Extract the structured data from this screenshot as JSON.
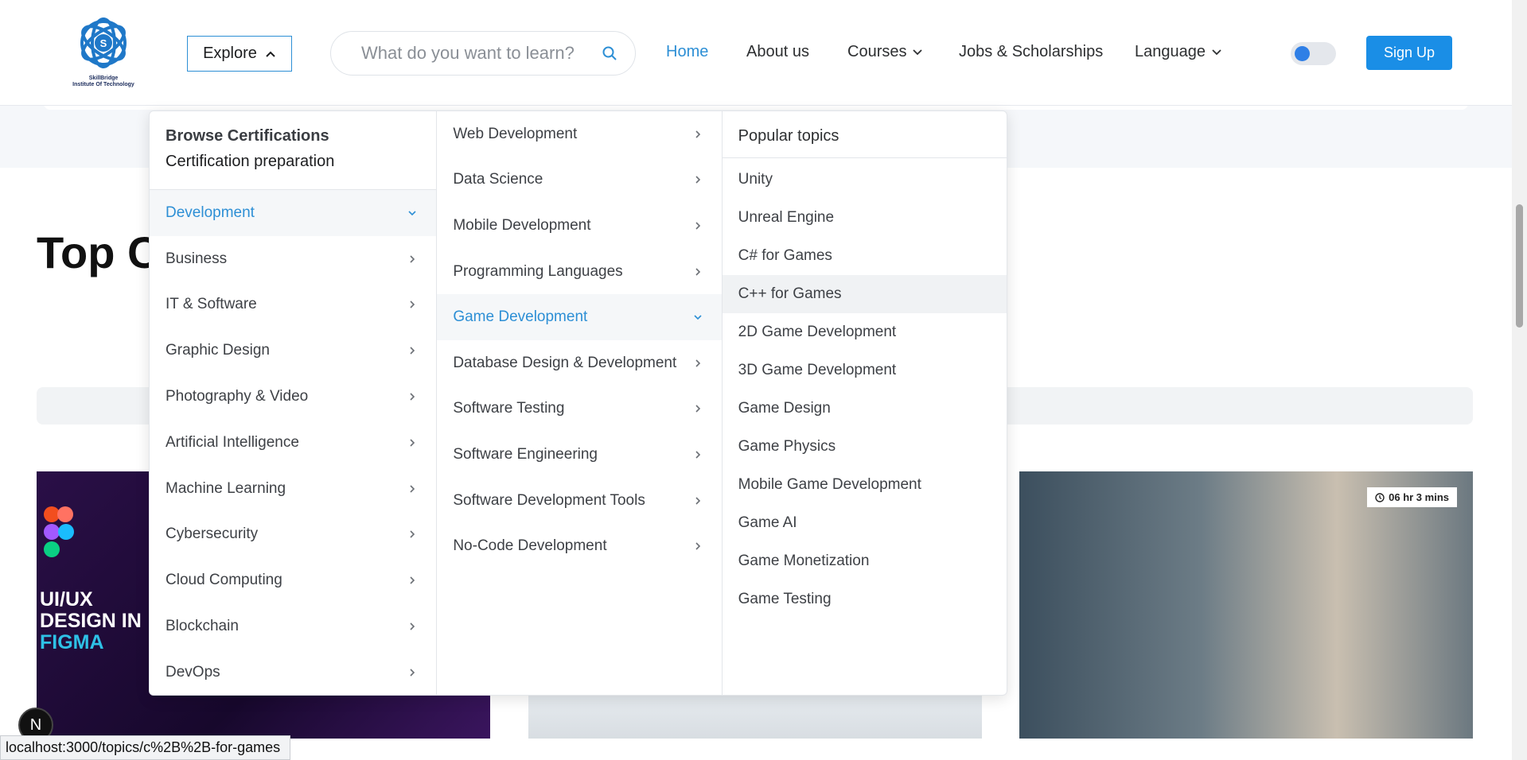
{
  "header": {
    "logo_text_line1": "SkillBridge",
    "logo_text_line2": "Institute Of Technology",
    "explore_label": "Explore",
    "search_placeholder": "What do you want to learn?",
    "nav": {
      "home": "Home",
      "about": "About us",
      "courses": "Courses",
      "jobs": "Jobs & Scholarships",
      "language": "Language"
    },
    "signup_label": "Sign Up",
    "accent_color": "#2d8fd5"
  },
  "page": {
    "title_partial": "Top C",
    "card1_title_line1": "UI/UX",
    "card1_title_line2": "DESIGN IN",
    "card1_title_line3": "FIGMA",
    "card3_duration": "06 hr 3 mins"
  },
  "menu": {
    "browse_title": "Browse Certifications",
    "cert_prep": "Certification preparation",
    "categories": [
      "Development",
      "Business",
      "IT & Software",
      "Graphic Design",
      "Photography & Video",
      "Artificial Intelligence",
      "Machine Learning",
      "Cybersecurity",
      "Cloud Computing",
      "Blockchain",
      "DevOps"
    ],
    "subcategories": [
      "Web Development",
      "Data Science",
      "Mobile Development",
      "Programming Languages",
      "Game Development",
      "Database Design & Development",
      "Software Testing",
      "Software Engineering",
      "Software Development Tools",
      "No-Code Development"
    ],
    "popular_title": "Popular topics",
    "topics": [
      "Unity",
      "Unreal Engine",
      "C# for Games",
      "C++ for Games",
      "2D Game Development",
      "3D Game Development",
      "Game Design",
      "Game Physics",
      "Mobile Game Development",
      "Game AI",
      "Game Monetization",
      "Game Testing"
    ]
  },
  "status_bar": {
    "url": "localhost:3000/topics/c%2B%2B-for-games"
  },
  "badge": "N"
}
